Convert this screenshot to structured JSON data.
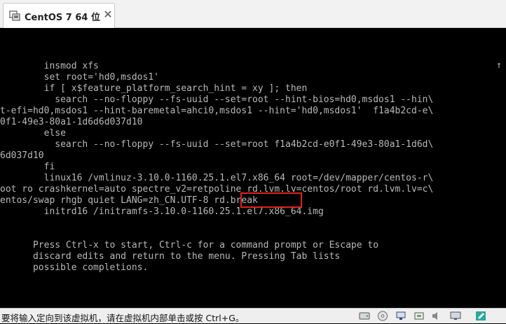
{
  "tab": {
    "title": "CentOS 7 64 位",
    "close": "✕"
  },
  "console": {
    "scroll_indicator": "↑",
    "lines": [
      "        insmod xfs",
      "        set root='hd0,msdos1'",
      "        if [ x$feature_platform_search_hint = xy ]; then",
      "          search --no-floppy --fs-uuid --set=root --hint-bios=hd0,msdos1 --hin\\",
      "t-efi=hd0,msdos1 --hint-baremetal=ahci0,msdos1 --hint='hd0,msdos1'  f1a4b2cd-e\\",
      "0f1-49e3-80a1-1d6d6d037d10",
      "        else",
      "          search --no-floppy --fs-uuid --set=root f1a4b2cd-e0f1-49e3-80a1-1d6d\\",
      "6d037d10",
      "        fi",
      "        linux16 /vmlinuz-3.10.0-1160.25.1.el7.x86_64 root=/dev/mapper/centos-r\\",
      "oot ro crashkernel=auto spectre_v2=retpoline rd.lvm.lv=centos/root rd.lvm.lv=c\\",
      "entos/swap rhgb quiet LANG=zh_CN.UTF-8 rd.break",
      "        initrd16 /initramfs-3.10.0-1160.25.1.el7.x86_64.img",
      "",
      "",
      "      Press Ctrl-x to start, Ctrl-c for a command prompt or Escape to",
      "      discard edits and return to the menu. Pressing Tab lists",
      "      possible completions."
    ]
  },
  "statusbar": {
    "message": "要将输入定向到该虚拟机，请在虚拟机内部单击或按 Ctrl+G。"
  },
  "colors": {
    "console_text": "#b9b9b9",
    "highlight": "#e02020"
  }
}
